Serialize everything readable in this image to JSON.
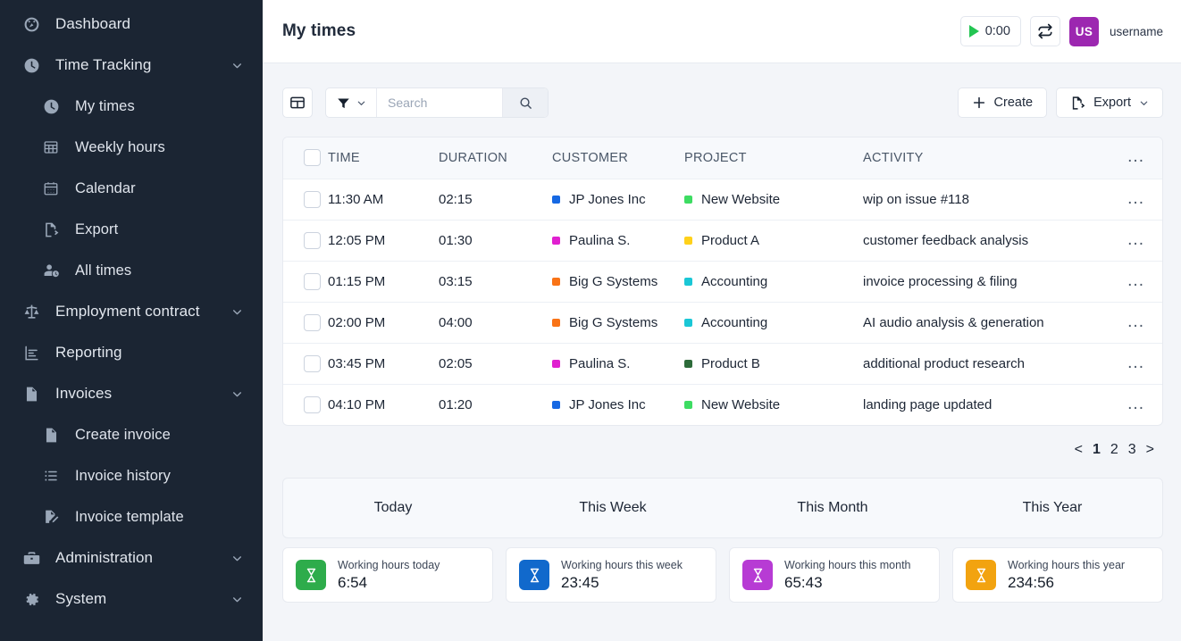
{
  "sidebar": {
    "items": [
      {
        "label": "Dashboard",
        "icon": "dashboard-icon",
        "level": "top",
        "expandable": false
      },
      {
        "label": "Time Tracking",
        "icon": "clock-icon",
        "level": "top",
        "expandable": true
      },
      {
        "label": "My times",
        "icon": "clock-icon",
        "level": "sub",
        "expandable": false
      },
      {
        "label": "Weekly hours",
        "icon": "grid-icon",
        "level": "sub",
        "expandable": false
      },
      {
        "label": "Calendar",
        "icon": "calendar-icon",
        "level": "sub",
        "expandable": false
      },
      {
        "label": "Export",
        "icon": "export-icon",
        "level": "sub",
        "expandable": false
      },
      {
        "label": "All times",
        "icon": "users-clock-icon",
        "level": "sub",
        "expandable": false
      },
      {
        "label": "Employment contract",
        "icon": "scales-icon",
        "level": "top",
        "expandable": true
      },
      {
        "label": "Reporting",
        "icon": "report-icon",
        "level": "top",
        "expandable": false
      },
      {
        "label": "Invoices",
        "icon": "invoice-icon",
        "level": "top",
        "expandable": true
      },
      {
        "label": "Create invoice",
        "icon": "invoice-icon",
        "level": "sub",
        "expandable": false
      },
      {
        "label": "Invoice history",
        "icon": "list-icon",
        "level": "sub",
        "expandable": false
      },
      {
        "label": "Invoice template",
        "icon": "edit-doc-icon",
        "level": "sub",
        "expandable": false
      },
      {
        "label": "Administration",
        "icon": "toolbox-icon",
        "level": "top",
        "expandable": true
      },
      {
        "label": "System",
        "icon": "gear-icon",
        "level": "top",
        "expandable": true
      }
    ]
  },
  "header": {
    "title": "My times",
    "timer_value": "0:00",
    "avatar_initials": "US",
    "username": "username",
    "avatar_color": "#9c27b0",
    "play_color": "#23c552"
  },
  "toolbar": {
    "search_placeholder": "Search",
    "search_value": "",
    "create_label": "Create",
    "export_label": "Export"
  },
  "table": {
    "columns": [
      "TIME",
      "DURATION",
      "CUSTOMER",
      "PROJECT",
      "ACTIVITY"
    ],
    "row_menu_glyph": "...",
    "rows": [
      {
        "time": "11:30 AM",
        "duration": "02:15",
        "customer": "JP Jones Inc",
        "customer_color": "#1668e3",
        "project": "New Website",
        "project_color": "#3ddc62",
        "activity": "wip on issue #118"
      },
      {
        "time": "12:05 PM",
        "duration": "01:30",
        "customer": "Paulina S.",
        "customer_color": "#e020d0",
        "project": "Product A",
        "project_color": "#ffd11a",
        "activity": "customer feedback analysis"
      },
      {
        "time": "01:15 PM",
        "duration": "03:15",
        "customer": "Big G Systems",
        "customer_color": "#f97316",
        "project": "Accounting",
        "project_color": "#1ac7d6",
        "activity": "invoice processing & filing"
      },
      {
        "time": "02:00 PM",
        "duration": "04:00",
        "customer": "Big G Systems",
        "customer_color": "#f97316",
        "project": "Accounting",
        "project_color": "#1ac7d6",
        "activity": "AI audio analysis & generation"
      },
      {
        "time": "03:45 PM",
        "duration": "02:05",
        "customer": "Paulina S.",
        "customer_color": "#e020d0",
        "project": "Product B",
        "project_color": "#2d6b3a",
        "activity": "additional product research"
      },
      {
        "time": "04:10 PM",
        "duration": "01:20",
        "customer": "JP Jones Inc",
        "customer_color": "#1668e3",
        "project": "New Website",
        "project_color": "#3ddc62",
        "activity": "landing page updated"
      }
    ]
  },
  "pagination": {
    "prev": "<",
    "pages": [
      "1",
      "2",
      "3"
    ],
    "current": "1",
    "next": ">"
  },
  "periods": [
    "Today",
    "This Week",
    "This Month",
    "This Year"
  ],
  "cards": [
    {
      "label": "Working hours today",
      "value": "6:54",
      "color": "#2eac4b"
    },
    {
      "label": "Working hours this week",
      "value": "23:45",
      "color": "#1169cc"
    },
    {
      "label": "Working hours this month",
      "value": "65:43",
      "color": "#b73bd4"
    },
    {
      "label": "Working hours this year",
      "value": "234:56",
      "color": "#f2a310"
    }
  ]
}
